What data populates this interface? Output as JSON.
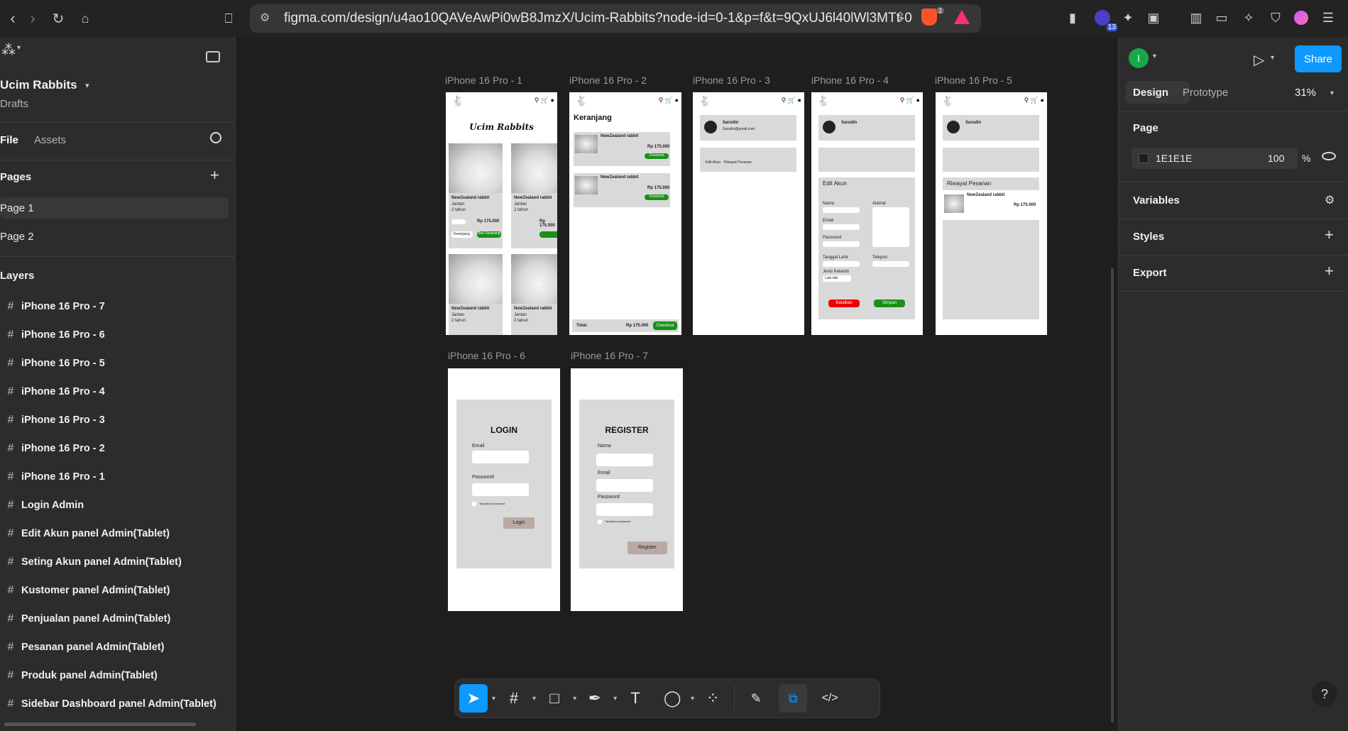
{
  "browser": {
    "url": "figma.com/design/u4ao10QAVeAwPi0wB8JmzX/Ucim-Rabbits?node-id=0-1&p=f&t=9QxUJ6l40lWl3MTt-0",
    "shield_badge": "2",
    "ext_badge": "13"
  },
  "left": {
    "project_title": "Ucim Rabbits",
    "project_sub": "Drafts",
    "tab_file": "File",
    "tab_assets": "Assets",
    "pages_title": "Pages",
    "pages": [
      "Page 1",
      "Page 2"
    ],
    "layers_title": "Layers",
    "layers": [
      "iPhone 16 Pro - 7",
      "iPhone 16 Pro - 6",
      "iPhone 16 Pro - 5",
      "iPhone 16 Pro - 4",
      "iPhone 16 Pro - 3",
      "iPhone 16 Pro - 2",
      "iPhone 16 Pro - 1",
      "Login Admin",
      "Edit Akun panel Admin(Tablet)",
      "Seting Akun panel Admin(Tablet)",
      "Kustomer panel Admin(Tablet)",
      "Penjualan panel Admin(Tablet)",
      "Pesanan panel Admin(Tablet)",
      "Produk panel Admin(Tablet)",
      "Sidebar Dashboard panel Admin(Tablet)"
    ]
  },
  "frames": {
    "f1": "iPhone 16 Pro - 1",
    "f2": "iPhone 16 Pro - 2",
    "f3": "iPhone 16 Pro - 3",
    "f4": "iPhone 16 Pro - 4",
    "f5": "iPhone 16 Pro - 5",
    "f6": "iPhone 16 Pro - 6",
    "f7": "iPhone 16 Pro - 7",
    "shop_title": "Ucim Rabbits",
    "product_name": "NewZealand rabbit",
    "product_gender": "Jantan",
    "product_age": "2 tahun",
    "product_price": "Rp 175.000",
    "btn_keranjang": "Keranjang",
    "btn_beli": "Beli Sekarang",
    "cart_title": "Keranjang",
    "checkout": "Checkout",
    "total_label": "Total:",
    "total_price": "Rp 175.000",
    "user_name": "Sarudin",
    "user_email": "Sarudin@gmail.com",
    "edit_akun": "Edit Akun",
    "riwayat": "Riwayat Pesanan",
    "label_nama": "Nama",
    "label_alamat": "Alamat",
    "label_email": "Email",
    "label_password": "Password",
    "label_tgl": "Tanggal Lahir",
    "label_telp": "Telepon",
    "label_jk": "Jenis Kelamin",
    "jk_value": "Laki-laki",
    "btn_batal": "Batalkan",
    "btn_simpan": "Simpan",
    "login_title": "LOGIN",
    "register_title": "REGISTER",
    "tampilkan": "Tampilkan password",
    "btn_login": "Login",
    "btn_register": "Register"
  },
  "right": {
    "avatar": "I",
    "share": "Share",
    "tab_design": "Design",
    "tab_prototype": "Prototype",
    "zoom": "31%",
    "page_title": "Page",
    "bg_hex": "1E1E1E",
    "bg_opacity": "100",
    "pct": "%",
    "variables": "Variables",
    "styles": "Styles",
    "export": "Export"
  },
  "colors": {
    "accent": "#0d99ff",
    "canvas_bg": "#1E1E1E",
    "green": "#1a8f1a",
    "red": "#e00000"
  }
}
